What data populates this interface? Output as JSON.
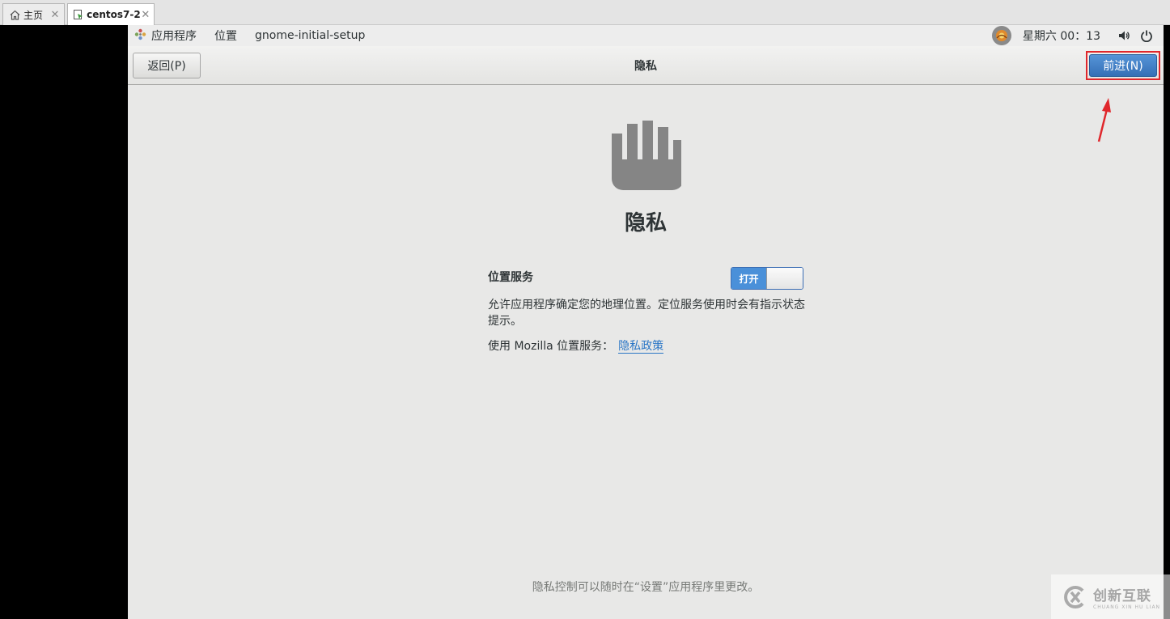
{
  "vm_tabs": [
    {
      "label": "主页",
      "icon": "home-icon"
    },
    {
      "label": "centos7-2",
      "icon": "vm-icon"
    }
  ],
  "topbar": {
    "apps_label": "应用程序",
    "places_label": "位置",
    "app_label": "gnome-initial-setup",
    "clock": "星期六 00：13"
  },
  "header": {
    "back_label": "返回(P)",
    "title": "隐私",
    "next_label": "前进(N)"
  },
  "main": {
    "heading": "隐私",
    "location_services_label": "位置服务",
    "toggle_on_label": "打开",
    "toggle_state": "on",
    "description": "允许应用程序确定您的地理位置。定位服务使用时会有指示状态提示。",
    "mozilla_text": "使用 Mozilla 位置服务：",
    "policy_link": "隐私政策",
    "footer_note": "隐私控制可以随时在“设置”应用程序里更改。"
  },
  "watermark": {
    "cn": "创新互联",
    "en": "CHUANG XIN HU LIAN"
  },
  "colors": {
    "accent": "#4a90d9",
    "highlight": "#e0272c",
    "link": "#2a76c6",
    "guest_bg": "#e8e8e7"
  }
}
